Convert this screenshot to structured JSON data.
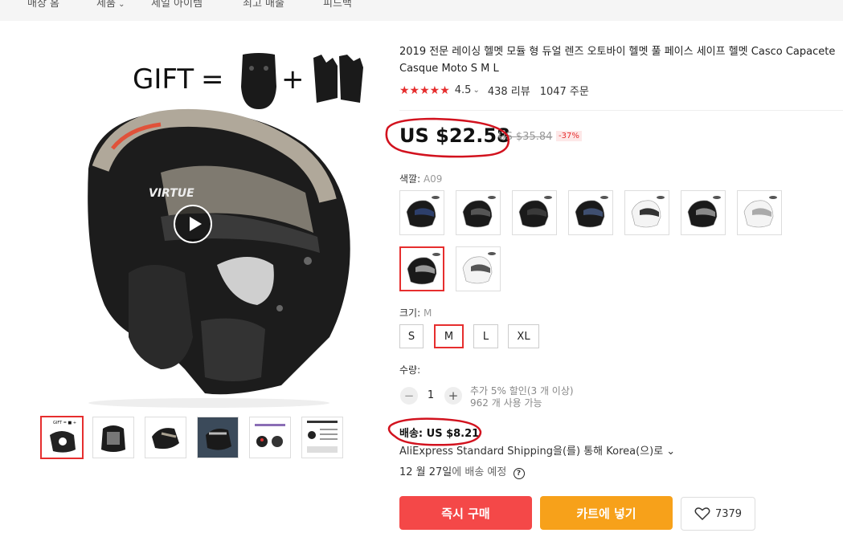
{
  "nav": {
    "items": [
      "매장 홈",
      "제품",
      "세일 아이템",
      "최고 매출",
      "피드백"
    ]
  },
  "gallery": {
    "gift_text": "GIFT",
    "equals": "=",
    "plus": "+",
    "selected_thumb_index": 0
  },
  "product": {
    "title": "2019 전문 레이싱 헬멧 모듈 형 듀얼 렌즈 오토바이 헬멧 풀 페이스 세이프 헬멧 Casco Capacete Casque Moto S M L",
    "rating_value": "4.5",
    "rating_chevron": "⌄",
    "stars": "★★★★★",
    "reviews": "438 리뷰",
    "orders": "1047 주문",
    "price": "US $22.58",
    "old_price": "US $35.84",
    "discount": "-37%"
  },
  "color": {
    "label": "색깔:",
    "value": "A09"
  },
  "size": {
    "label": "크기:",
    "value": "M",
    "options": [
      "S",
      "M",
      "L",
      "XL"
    ]
  },
  "quantity": {
    "label": "수량:",
    "value": "1",
    "minus": "−",
    "plus": "+",
    "note1": "추가 5% 할인(3 개 이상)",
    "note2": "962 개 사용 가능"
  },
  "shipping": {
    "cost": "배송: US $8.21",
    "method": "AliExpress Standard Shipping을(를) 통해 Korea(으)로 ⌄",
    "date": "12 월 27일",
    "date_suffix": "에 배송 예정"
  },
  "actions": {
    "buy_now": "즉시 구매",
    "add_to_cart": "카트에 넣기",
    "wishlist_count": "7379"
  },
  "colors": {
    "accent": "#e62e2e",
    "buy_button": "#f44848",
    "cart_button": "#f7a11a",
    "annotation": "#d2121e"
  }
}
